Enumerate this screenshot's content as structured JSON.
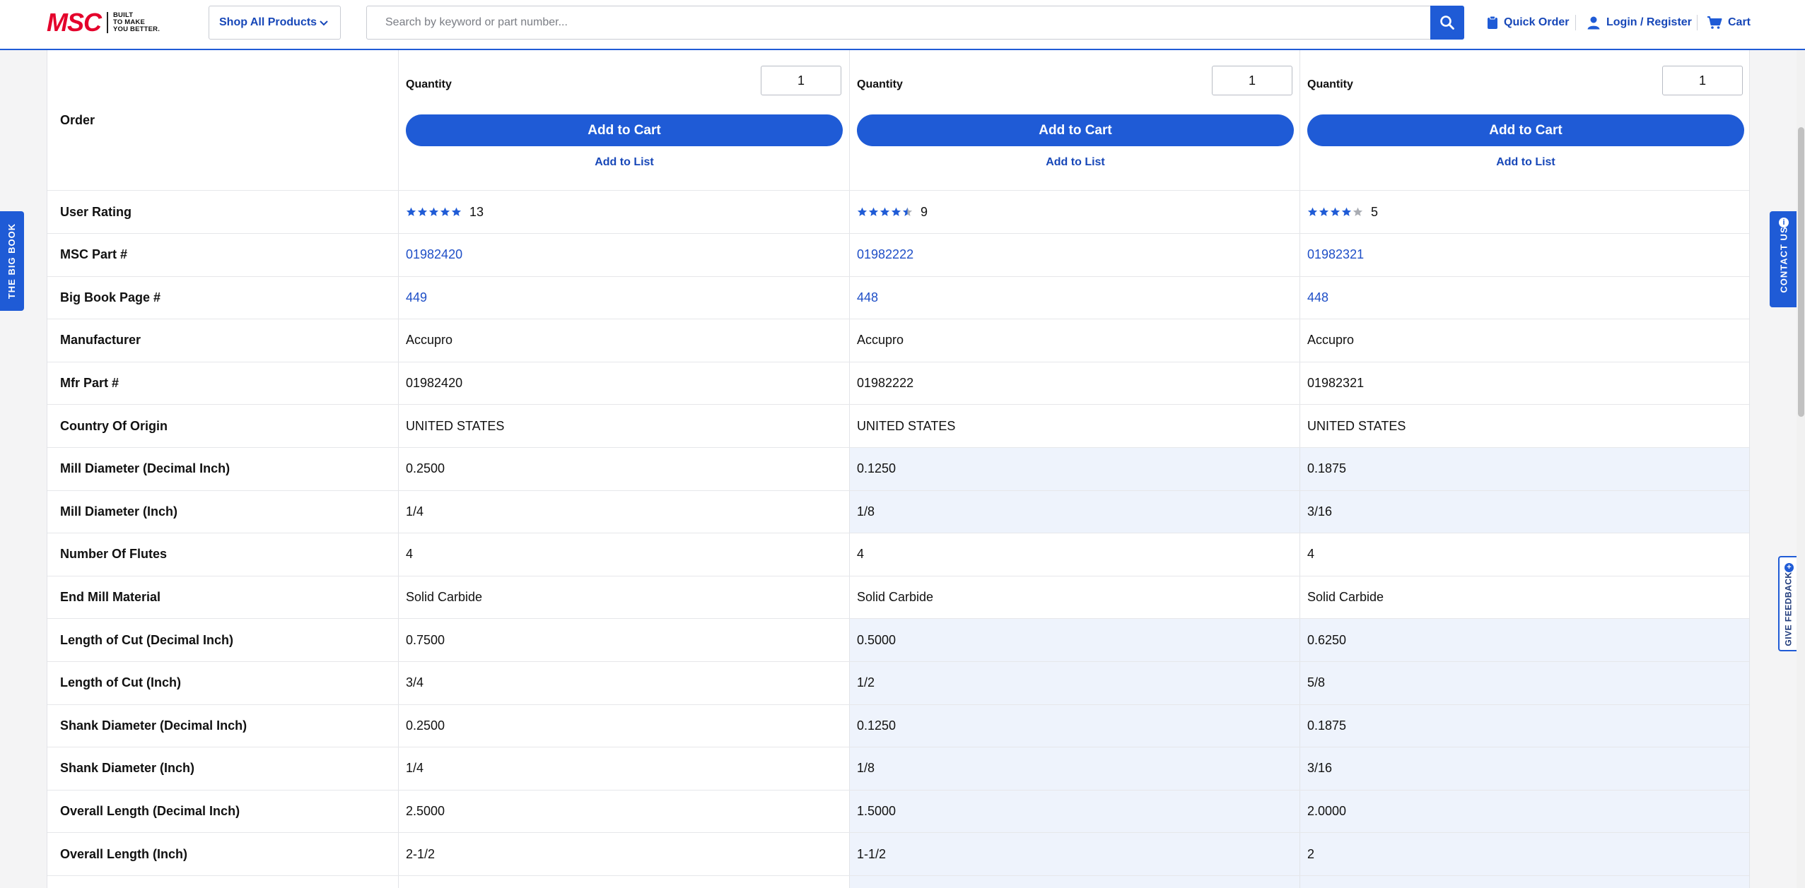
{
  "header": {
    "logo_text": "MSC",
    "logo_tagline": [
      "BUILT",
      "TO MAKE",
      "YOU BETTER."
    ],
    "shop_all_label": "Shop All Products",
    "search_placeholder": "Search by keyword or part number...",
    "quick_order_label": "Quick Order",
    "login_label": "Login / Register",
    "cart_label": "Cart",
    "brand_color": "#1f5bd6",
    "logo_color": "#e4002b"
  },
  "side_tabs": {
    "big_book": "THE BIG BOOK",
    "contact_us": "CONTACT US",
    "give_feedback": "GIVE FEEDBACK"
  },
  "order_row": {
    "label": "Order",
    "quantity_label": "Quantity",
    "add_to_cart_label": "Add to Cart",
    "add_to_list_label": "Add to List",
    "quantities": [
      "1",
      "1",
      "1"
    ]
  },
  "rating_row": {
    "label": "User Rating",
    "products": [
      {
        "stars": 5,
        "count": "13"
      },
      {
        "stars": 4.5,
        "count": "9"
      },
      {
        "stars": 4,
        "count": "5"
      }
    ]
  },
  "spec_rows": [
    {
      "label": "MSC Part #",
      "values": [
        "01982420",
        "01982222",
        "01982321"
      ],
      "link": true,
      "diff": false
    },
    {
      "label": "Big Book Page #",
      "values": [
        "449",
        "448",
        "448"
      ],
      "link": true,
      "diff": false
    },
    {
      "label": "Manufacturer",
      "values": [
        "Accupro",
        "Accupro",
        "Accupro"
      ],
      "link": false,
      "diff": false
    },
    {
      "label": "Mfr Part #",
      "values": [
        "01982420",
        "01982222",
        "01982321"
      ],
      "link": false,
      "diff": false
    },
    {
      "label": "Country Of Origin",
      "values": [
        "UNITED STATES",
        "UNITED STATES",
        "UNITED STATES"
      ],
      "link": false,
      "diff": false
    },
    {
      "label": "Mill Diameter (Decimal Inch)",
      "values": [
        "0.2500",
        "0.1250",
        "0.1875"
      ],
      "link": false,
      "diff": true
    },
    {
      "label": "Mill Diameter (Inch)",
      "values": [
        "1/4",
        "1/8",
        "3/16"
      ],
      "link": false,
      "diff": true
    },
    {
      "label": "Number Of Flutes",
      "values": [
        "4",
        "4",
        "4"
      ],
      "link": false,
      "diff": false
    },
    {
      "label": "End Mill Material",
      "values": [
        "Solid Carbide",
        "Solid Carbide",
        "Solid Carbide"
      ],
      "link": false,
      "diff": false
    },
    {
      "label": "Length of Cut (Decimal Inch)",
      "values": [
        "0.7500",
        "0.5000",
        "0.6250"
      ],
      "link": false,
      "diff": true
    },
    {
      "label": "Length of Cut (Inch)",
      "values": [
        "3/4",
        "1/2",
        "5/8"
      ],
      "link": false,
      "diff": true
    },
    {
      "label": "Shank Diameter (Decimal Inch)",
      "values": [
        "0.2500",
        "0.1250",
        "0.1875"
      ],
      "link": false,
      "diff": true
    },
    {
      "label": "Shank Diameter (Inch)",
      "values": [
        "1/4",
        "1/8",
        "3/16"
      ],
      "link": false,
      "diff": true
    },
    {
      "label": "Overall Length (Decimal Inch)",
      "values": [
        "2.5000",
        "1.5000",
        "2.0000"
      ],
      "link": false,
      "diff": true
    },
    {
      "label": "Overall Length (Inch)",
      "values": [
        "2-1/2",
        "1-1/2",
        "2"
      ],
      "link": false,
      "diff": true
    },
    {
      "label": "",
      "values": [
        "",
        "",
        ""
      ],
      "link": false,
      "diff": true
    }
  ]
}
